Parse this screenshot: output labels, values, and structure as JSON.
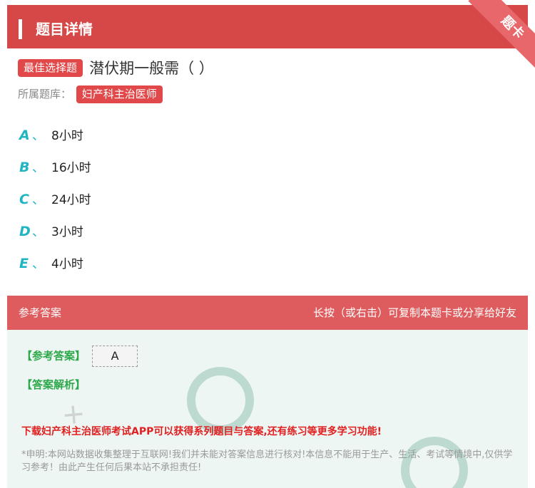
{
  "header": {
    "title": "题目详情",
    "ribbon": "题卡"
  },
  "question": {
    "type_tag": "最佳选择题",
    "text": "潜伏期一般需（ ）",
    "bank_label": "所属题库：",
    "bank_tag": "妇产科主治医师"
  },
  "options": [
    {
      "letter": "A",
      "sep": "、",
      "text": "8小时"
    },
    {
      "letter": "B",
      "sep": "、",
      "text": "16小时"
    },
    {
      "letter": "C",
      "sep": "、",
      "text": "24小时"
    },
    {
      "letter": "D",
      "sep": "、",
      "text": "3小时"
    },
    {
      "letter": "E",
      "sep": "、",
      "text": "4小时"
    }
  ],
  "answer": {
    "section_title": "参考答案",
    "share_hint": "长按（或右击）可复制本题卡或分享给好友",
    "ref_label": "【参考答案】",
    "ref_value": "A",
    "analysis_label": "【答案解析】",
    "promo": "下载妇产科主治医师考试APP可以获得系列题目与答案,还有练习等更多学习功能!",
    "disclaimer": "*申明:本网站数据收集整理于互联网!我们并未能对答案信息进行核对!本信息不能用于生产、生活、考试等情境中,仅供学习参考！由此产生任何后果本站不承担责任!"
  },
  "colors": {
    "header_bg": "#d64748",
    "accent_teal": "#21b5c3",
    "tag_red": "#e0484a",
    "answer_green": "#2da84a",
    "promo_red": "#e02020"
  }
}
